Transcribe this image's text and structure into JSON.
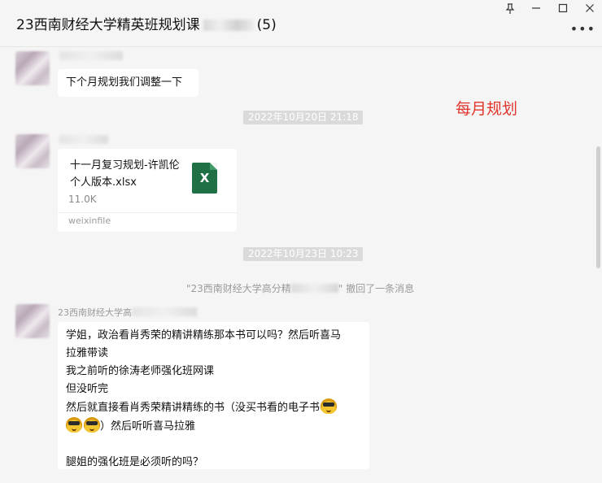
{
  "window": {
    "title": "23西南财经大学精英班规划课",
    "member_count": "(5)",
    "more_glyph": "•••"
  },
  "messages": {
    "msg1": {
      "text": "下个月规划我们调整一下"
    },
    "ts1": "2022年10月20日 21:18",
    "file": {
      "title": "十一月复习规划-许凯伦个人版本.xlsx",
      "size": "11.0K",
      "source": "weixinfile",
      "icon_letter": "X",
      "icon_color": "#1f7145"
    },
    "ts2": "2022年10月23日 10:23",
    "recall": {
      "before": "\"23西南财经大学高分精",
      "after": "\" 撤回了一条消息"
    },
    "sender_name_prefix": "23西南财经大学高",
    "long_msg": {
      "line1": "学姐，政治看肖秀荣的精讲精练那本书可以吗？然后听喜马",
      "line2": "拉雅带读",
      "line3": "我之前听的徐涛老师强化班网课",
      "line4": "但没听完",
      "line5": "然后就直接看肖秀荣精讲精练的书（没买书看的电子书",
      "line6": "）然后听听喜马拉雅",
      "line7": "腿姐的强化班是必须听的吗？"
    }
  },
  "annotation": {
    "text": "每月规划",
    "color": "#e2352b"
  }
}
